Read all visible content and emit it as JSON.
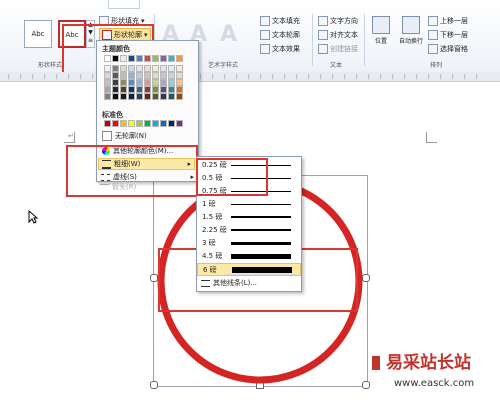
{
  "ribbon": {
    "tabs": [
      "",
      "",
      ""
    ],
    "styles": [
      {
        "label": "Abc",
        "selected": false
      },
      {
        "label": "Abc",
        "selected": true
      }
    ],
    "group_shape_styles": "形状样式",
    "group_wordart": "艺术字样式",
    "group_text": "文本",
    "group_arrange": "排列",
    "shape_fill": "形状填充",
    "shape_outline": "形状轮廓",
    "text_fill": "文本填充",
    "text_outline": "文本轮廓",
    "text_effects": "文本效果",
    "text_direction": "文字方向",
    "align_text": "对齐文本",
    "create_link": "创建链接",
    "position": "位置",
    "wrap_text": "自动换行",
    "bring_forward": "上移一层",
    "send_backward": "下移一层",
    "selection_pane": "选择窗格"
  },
  "dropdown": {
    "theme_colors_header": "主题颜色",
    "standard_colors_header": "标准色",
    "no_outline": "无轮廓(N)",
    "more_colors": "其他轮廓颜色(M)...",
    "weight": "粗细(W)",
    "dashes": "虚线(S)",
    "arrows": "箭头(R)",
    "theme_colors": [
      [
        "#ffffff",
        "#000000",
        "#eeece1",
        "#1f497d",
        "#4f81bd",
        "#c0504d",
        "#9bbb59",
        "#8064a2",
        "#4bacc6",
        "#f79646"
      ],
      [
        "#f2f2f2",
        "#7f7f7f",
        "#ddd9c3",
        "#c6d9f0",
        "#dbe5f1",
        "#f2dcdb",
        "#ebf1dd",
        "#e5e0ec",
        "#dbeef3",
        "#fdeada"
      ],
      [
        "#d8d8d8",
        "#595959",
        "#c4bd97",
        "#8db3e2",
        "#b8cce4",
        "#e5b9b7",
        "#d7e3bc",
        "#ccc1d9",
        "#b7dde8",
        "#fbd5b5"
      ],
      [
        "#bfbfbf",
        "#3f3f3f",
        "#938953",
        "#548dd4",
        "#95b3d7",
        "#d99694",
        "#c3d69b",
        "#b2a2c7",
        "#92cddc",
        "#fac08f"
      ],
      [
        "#a5a5a5",
        "#262626",
        "#494429",
        "#17365d",
        "#366092",
        "#953734",
        "#76923c",
        "#5f497a",
        "#31859b",
        "#e36c09"
      ],
      [
        "#7f7f7f",
        "#0c0c0c",
        "#1d1b10",
        "#0f243e",
        "#244061",
        "#632423",
        "#4f6128",
        "#3f3151",
        "#205867",
        "#974806"
      ]
    ],
    "standard_colors": [
      "#c00000",
      "#ff0000",
      "#ffc000",
      "#ffff00",
      "#92d050",
      "#00b050",
      "#00b0f0",
      "#0070c0",
      "#002060",
      "#7030a0"
    ]
  },
  "submenu": {
    "weights": [
      {
        "label": "0.25 磅",
        "thickness": 0.25
      },
      {
        "label": "0.5 磅",
        "thickness": 0.5
      },
      {
        "label": "0.75 磅",
        "thickness": 0.75
      },
      {
        "label": "1 磅",
        "thickness": 1
      },
      {
        "label": "1.5 磅",
        "thickness": 1.5
      },
      {
        "label": "2.25 磅",
        "thickness": 2.25
      },
      {
        "label": "3 磅",
        "thickness": 3
      },
      {
        "label": "4.5 磅",
        "thickness": 4.5
      },
      {
        "label": "6 磅",
        "thickness": 6
      }
    ],
    "selected_weight": "6 磅",
    "more_lines": "其他线条(L)..."
  },
  "document": {
    "circle_color": "#d42424"
  },
  "watermark": {
    "brand": "易采站长站",
    "url": "www.easck.com"
  },
  "colors": {
    "highlight_box": "#d9372f",
    "menu_hover": "#fce9a6"
  }
}
